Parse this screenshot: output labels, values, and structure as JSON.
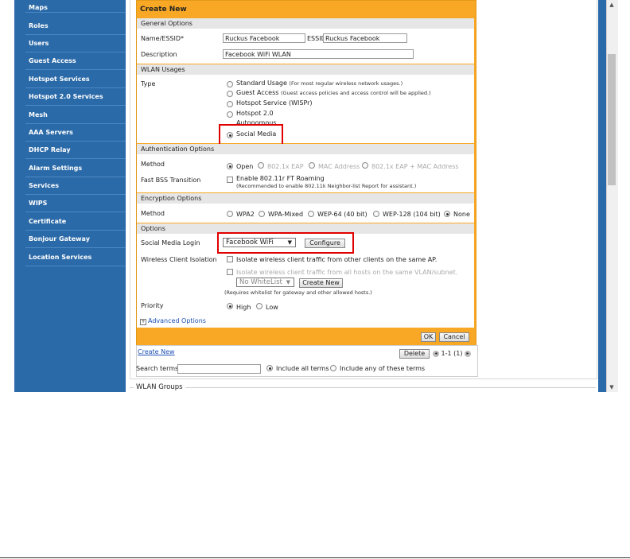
{
  "nav": {
    "items": [
      "Maps",
      "Roles",
      "Users",
      "Guest Access",
      "Hotspot Services",
      "Hotspot 2.0 Services",
      "Mesh",
      "AAA Servers",
      "DHCP Relay",
      "Alarm Settings",
      "Services",
      "WIPS",
      "Certificate",
      "Bonjour Gateway",
      "Location Services"
    ]
  },
  "panel": {
    "title": "Create New",
    "general_options": "General Options",
    "name_label": "Name/ESSID*",
    "name_value": "Ruckus Facebook",
    "essid_label": "ESSID",
    "essid_value": "Ruckus Facebook",
    "description_label": "Description",
    "description_value": "Facebook WiFi WLAN",
    "wlan_usages": "WLAN Usages",
    "type_label": "Type",
    "type_options": [
      {
        "main": "Standard Usage",
        "note": "(For most regular wireless network usages.)"
      },
      {
        "main": "Guest Access",
        "note": "(Guest access policies and access control will be applied.)"
      },
      {
        "main": "Hotspot Service (WISPr)",
        "note": ""
      },
      {
        "main": "Hotspot 2.0",
        "note": ""
      },
      {
        "main": "Autonomous",
        "note": ""
      },
      {
        "main": "Social Media",
        "note": ""
      }
    ],
    "auth_options": "Authentication Options",
    "method_label": "Method",
    "auth_methods": [
      "Open",
      "802.1x EAP",
      "MAC Address",
      "802.1x EAP + MAC Address"
    ],
    "fbss_label": "Fast BSS Transition",
    "fbss_text": "Enable 802.11r FT Roaming",
    "fbss_note": "(Recommended to enable 802.11k Neighbor-list Report for assistant.)",
    "enc_options": "Encryption Options",
    "enc_method_label": "Method",
    "enc_methods": [
      "WPA2",
      "WPA-Mixed",
      "WEP-64 (40 bit)",
      "WEP-128 (104 bit)",
      "None"
    ],
    "options": "Options",
    "social_label": "Social Media Login",
    "social_value": "Facebook WiFi",
    "configure_label": "Configure",
    "isolation_label": "Wireless Client Isolation",
    "isolation_opt1": "Isolate wireless client traffic from other clients on the same AP.",
    "isolation_opt2": "Isolate wireless client traffic from all hosts on the same VLAN/subnet.",
    "whitelist_value": "No WhiteList",
    "create_new_btn": "Create New",
    "whitelist_note": "(Requires whitelist for gateway and other allowed hosts.)",
    "priority_label": "Priority",
    "priority_options": [
      "High",
      "Low"
    ],
    "advanced": "Advanced Options",
    "ok_label": "OK",
    "cancel_label": "Cancel"
  },
  "footer": {
    "create_new_link": "Create New",
    "delete_label": "Delete",
    "pagination": "1-1 (1)",
    "search_label": "Search terms",
    "include_all": "Include all terms",
    "include_any": "Include any of these terms"
  },
  "groups": {
    "title": "WLAN Groups"
  },
  "colors": {
    "nav": "#2b6aa8",
    "panel": "#f8a825",
    "highlight": "#e00000"
  }
}
